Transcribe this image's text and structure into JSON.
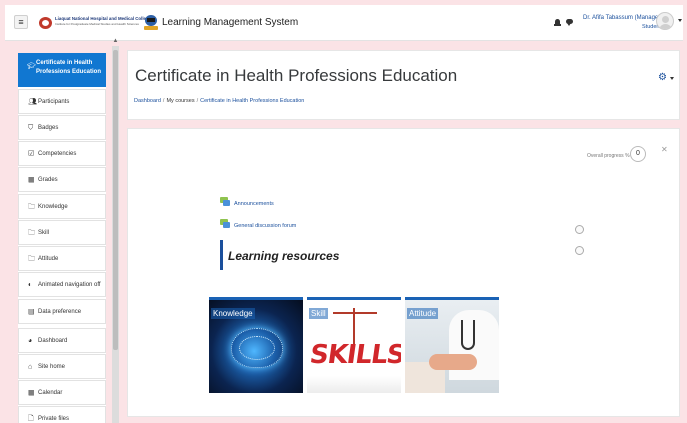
{
  "topbar": {
    "menu_icon": "hamburger-icon",
    "logo_name": "Liaquat National Hospital and Medical College",
    "logo_subtitle": "Institute for Postgraduate Medical Studies and Health Sciences",
    "site_name": "Learning Management System",
    "notification_icon": "bell-icon",
    "message_icon": "chat-icon",
    "user_name": "Dr. Afifa Tabassum (Manager)",
    "user_role": "Student"
  },
  "sidebar": {
    "items": [
      {
        "label": "Certificate in Health Professions Education",
        "icon": "graduation-cap-icon",
        "active": true
      },
      {
        "label": "Participants",
        "icon": "users-icon"
      },
      {
        "label": "Badges",
        "icon": "shield-icon"
      },
      {
        "label": "Competencies",
        "icon": "checkbox-icon"
      },
      {
        "label": "Grades",
        "icon": "table-icon"
      },
      {
        "label": "Knowledge",
        "icon": "folder-icon"
      },
      {
        "label": "Skill",
        "icon": "folder-icon"
      },
      {
        "label": "Attitude",
        "icon": "folder-icon"
      },
      {
        "label": "Animated navigation off",
        "icon": "toggle-icon"
      },
      {
        "label": "Data preference",
        "icon": "document-icon"
      },
      {
        "label": "Dashboard",
        "icon": "dashboard-icon"
      },
      {
        "label": "Site home",
        "icon": "home-icon"
      },
      {
        "label": "Calendar",
        "icon": "calendar-icon"
      },
      {
        "label": "Private files",
        "icon": "file-icon"
      }
    ]
  },
  "header": {
    "title": "Certificate in Health Professions Education",
    "breadcrumb": [
      "Dashboard",
      "My courses",
      "Certificate in Health Professions Education"
    ],
    "settings_icon": "gear-icon"
  },
  "course": {
    "progress_label": "Overall progress %",
    "progress_value": "0",
    "activities": [
      {
        "label": "Announcements",
        "icon": "forum-icon"
      },
      {
        "label": "General discussion forum",
        "icon": "forum-icon"
      }
    ],
    "section_title": "Learning resources",
    "tiles": [
      {
        "label": "Knowledge"
      },
      {
        "label": "Skill",
        "image_text": "SKILLS"
      },
      {
        "label": "Attitude"
      }
    ]
  },
  "colors": {
    "accent": "#1177d1",
    "link": "#1a4f9c",
    "page_background": "#fbe3e6"
  }
}
